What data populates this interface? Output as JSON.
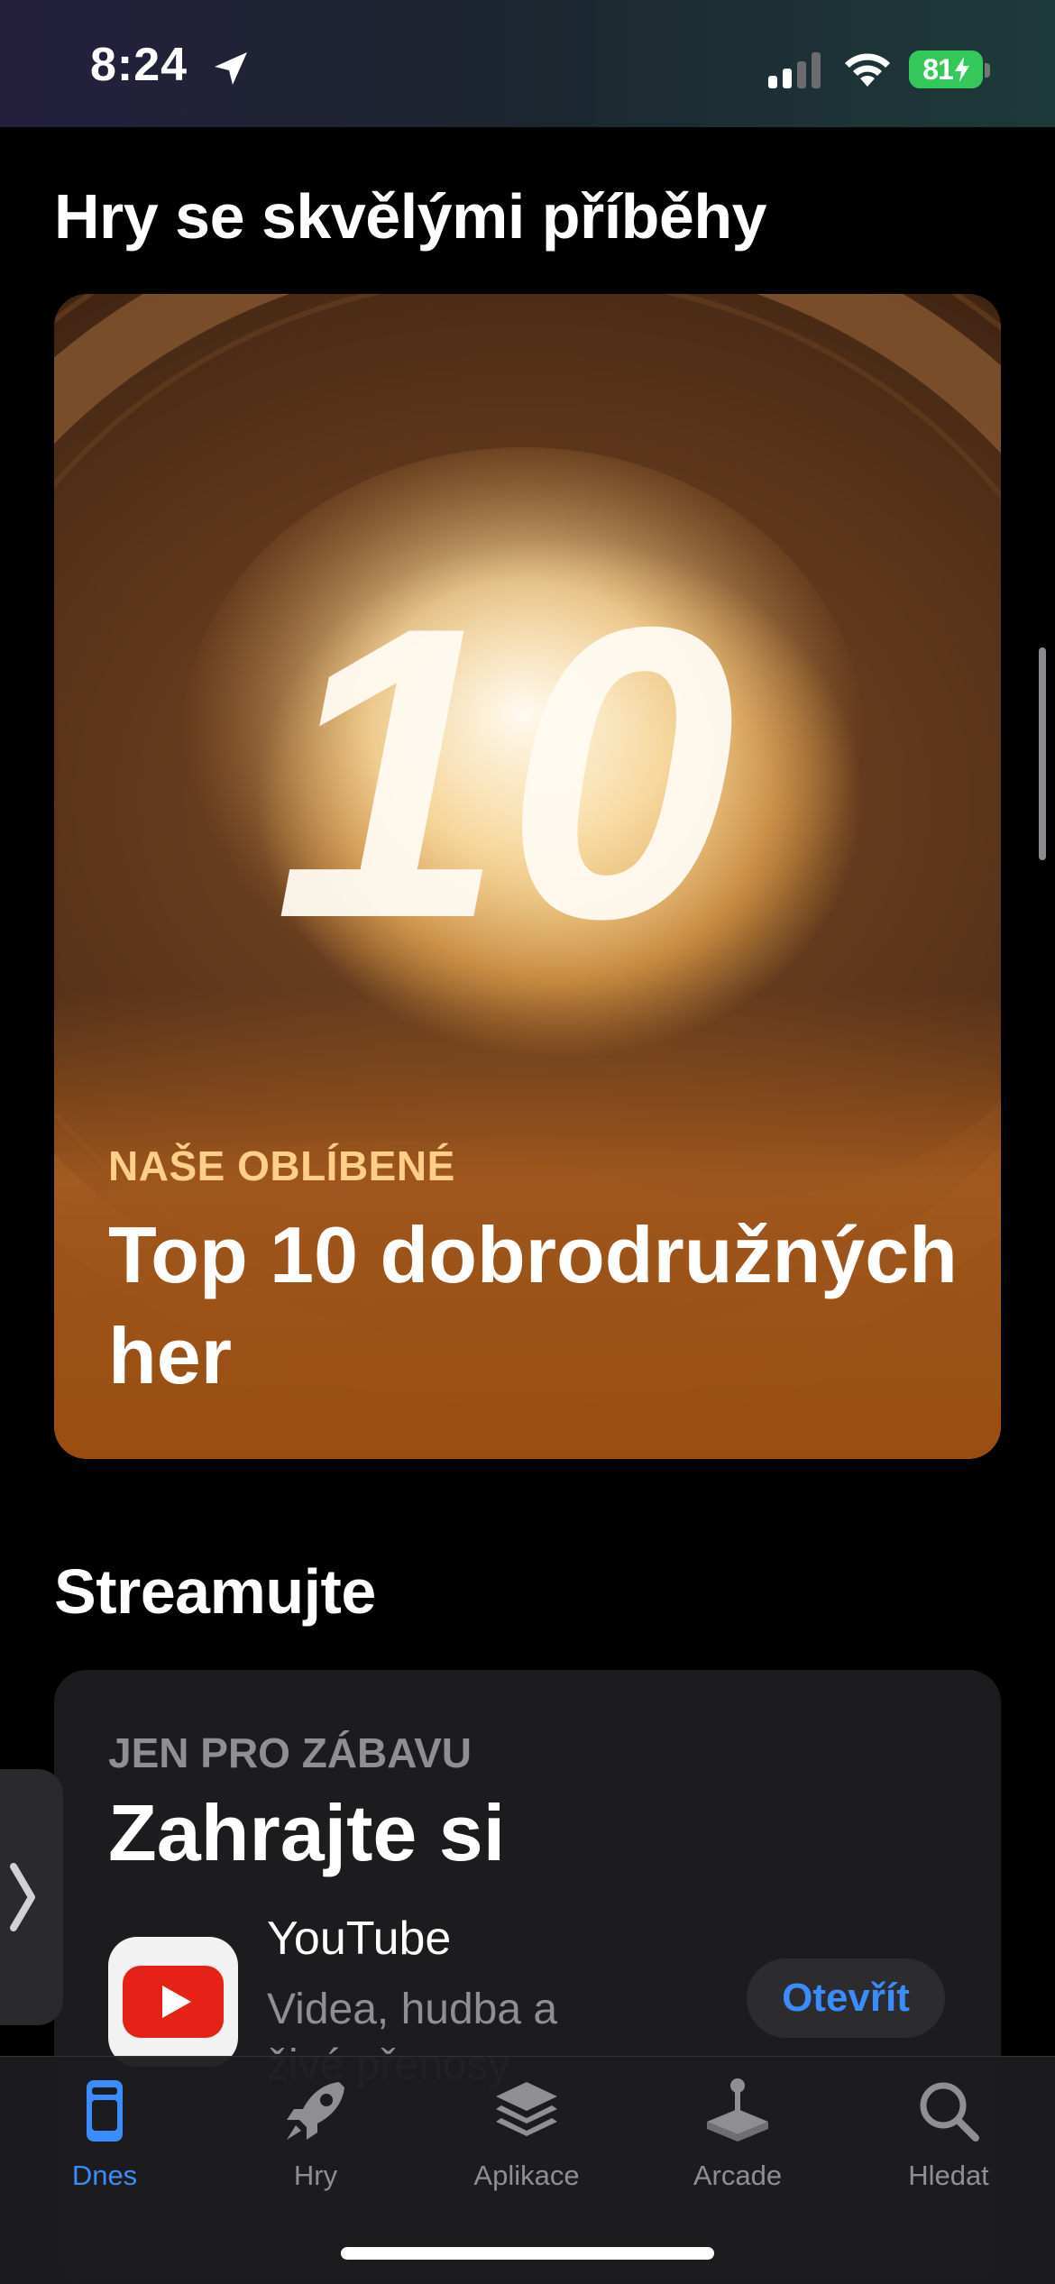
{
  "status_bar": {
    "time": "8:24",
    "battery": "81"
  },
  "sections": [
    {
      "title": "Hry se skvělými příběhy",
      "card": {
        "eyebrow": "NAŠE OBLÍBENÉ",
        "title": "Top 10 dobrodružných her",
        "art_text": "10",
        "eyebrow_color": "#ffcf8a"
      }
    },
    {
      "title": "Streamujte",
      "card": {
        "eyebrow": "JEN PRO ZÁBAVU",
        "title": "Zahrajte si",
        "app": {
          "name": "YouTube",
          "description": "Videa, hudba a živé přenosy",
          "action_label": "Otevřít",
          "icon": "youtube-icon"
        }
      }
    }
  ],
  "tab_bar": {
    "active": "Dnes",
    "accent_color": "#3b8cff",
    "tabs": [
      {
        "label": "Dnes",
        "icon": "today-icon"
      },
      {
        "label": "Hry",
        "icon": "rocket-icon"
      },
      {
        "label": "Aplikace",
        "icon": "layers-icon"
      },
      {
        "label": "Arcade",
        "icon": "joystick-icon"
      },
      {
        "label": "Hledat",
        "icon": "search-icon"
      }
    ]
  }
}
